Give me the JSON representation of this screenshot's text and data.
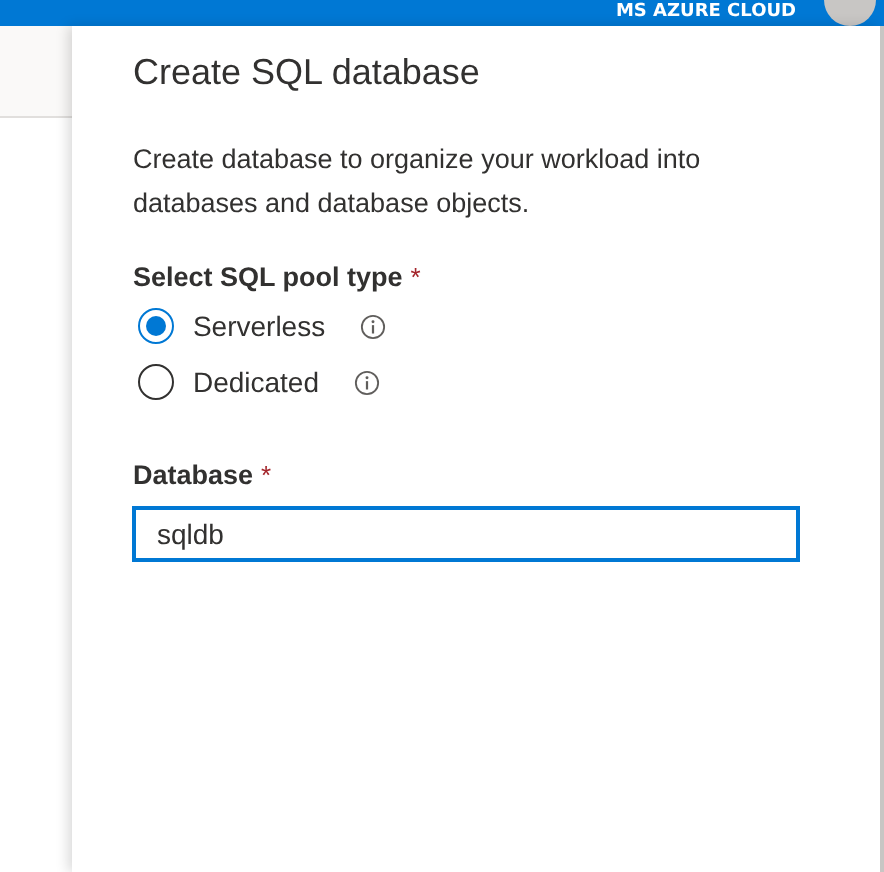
{
  "top_bar": {
    "account": "MS AZURE CLOUD"
  },
  "panel": {
    "title": "Create SQL database",
    "description": "Create database to organize your workload into databases and database objects."
  },
  "pool_type": {
    "label": "Select SQL pool type",
    "required_mark": "*",
    "options": [
      {
        "label": "Serverless",
        "selected": true
      },
      {
        "label": "Dedicated",
        "selected": false
      }
    ]
  },
  "database": {
    "label": "Database",
    "required_mark": "*",
    "value": "sqldb",
    "focused": true
  }
}
